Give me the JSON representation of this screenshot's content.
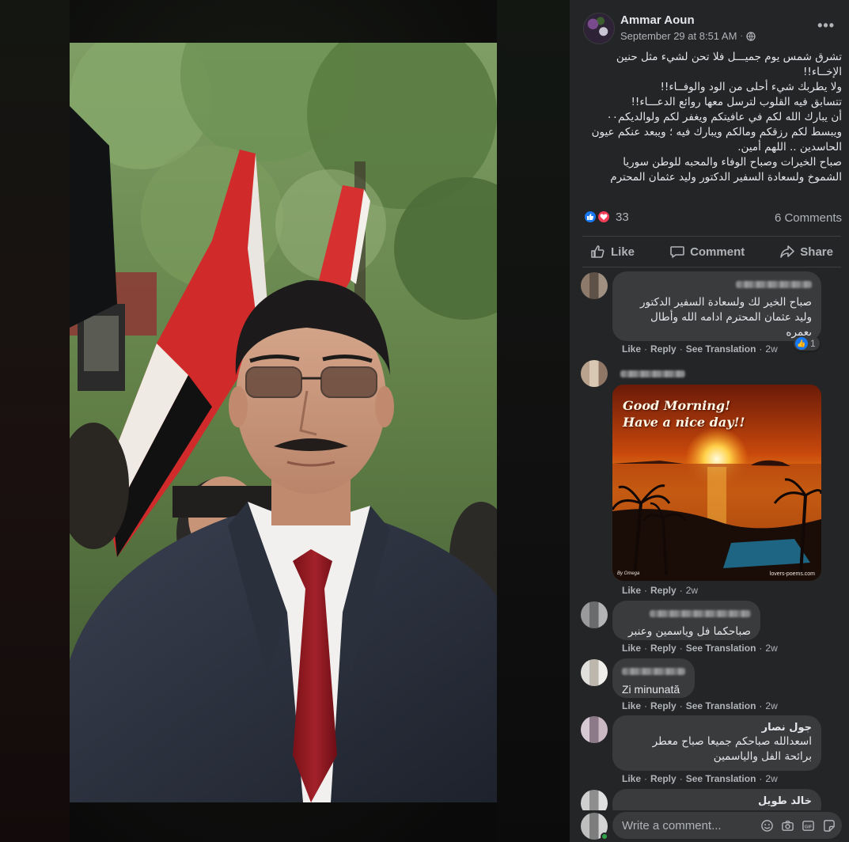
{
  "post": {
    "author": "Ammar Aoun",
    "timestamp": "September 29 at 8:51 AM",
    "privacy_icon": "globe-icon",
    "more_label": "•••",
    "text_lines": [
      "تشرق شمس يوم جميـــل فلا تحن لشيء مثل حنين",
      "الإخــاء!!",
      "ولا يطربك شيء أحلى من الود والوفــاء!!",
      "تتسابق فيه القلوب لترسل معها روائع الدعـــاء!!",
      "أن يبارك الله لكم في عافيتكم ويغفر لكم ولوالديكم٠٠",
      "ويبسط لكم رزقكم ومالكم ويبارك فيه ؛ ويبعد عنكم عيون",
      "الحاسدين .. اللهم أمين.",
      "صباح الخيرات وصباح الوفاء والمحبه للوطن سوريا",
      "الشموخ ولسعادة السفير الدكتور وليد عثمان المحترم"
    ],
    "reaction_count": "33",
    "comments_count": "6 Comments"
  },
  "actions": {
    "like": "Like",
    "comment": "Comment",
    "share": "Share"
  },
  "comment_actions": {
    "like": "Like",
    "reply": "Reply",
    "see_translation": "See Translation",
    "separator": "·"
  },
  "comments": [
    {
      "text": "صباح الخير لك ولسعادة السفير الدكتور وليد عثمان المحترم ادامه الله وأطال بعمره",
      "time": "2w",
      "reactions": "1"
    },
    {
      "image_text_1": "Good Morning!",
      "image_text_2": "Have a nice day!!",
      "image_credit": "lovers-poems.com",
      "image_signature": "By Omega",
      "time": "2w"
    },
    {
      "text": "صباحكما فل وياسمين وعنبر",
      "time": "2w"
    },
    {
      "text": "Zi minunată",
      "time": "2w"
    },
    {
      "name": "جول نصار",
      "text": "اسعدالله صباحكم جميعا صباح معطر برائحة الفل والياسمين",
      "time": "2w"
    },
    {
      "name": "خالد طويل"
    }
  ],
  "composer": {
    "placeholder": "Write a comment...",
    "icons": [
      "emoji-icon",
      "camera-icon",
      "gif-icon",
      "sticker-icon"
    ]
  },
  "colors": {
    "panel_bg": "#242526",
    "bubble_bg": "#3a3b3c",
    "primary_text": "#e4e6eb",
    "secondary_text": "#b0b3b8",
    "like_blue": "#1877f2",
    "love_red": "#f33e58",
    "online_green": "#31a24c"
  }
}
